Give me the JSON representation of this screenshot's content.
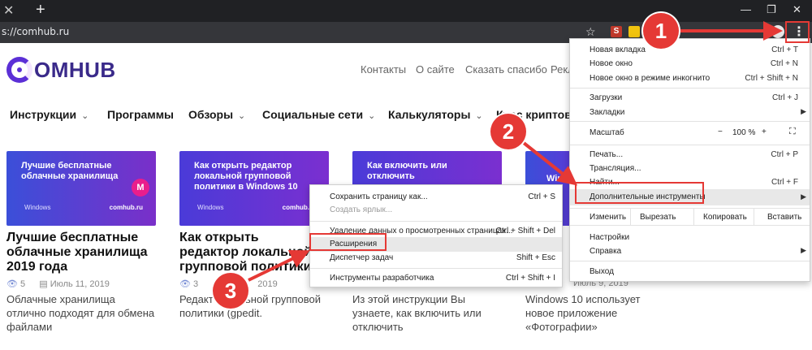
{
  "browser": {
    "url": "s://comhub.ru",
    "tab_close_glyph": "✕",
    "new_tab_glyph": "+",
    "window_controls": [
      "—",
      "❐",
      "✕"
    ],
    "ext_badge_letter": "S"
  },
  "site": {
    "logo_text": "OMHUB",
    "top_links": [
      "Контакты",
      "О сайте",
      "Сказать спасибо",
      "Рекл"
    ],
    "nav": [
      {
        "label": "Инструкции",
        "has_dropdown": true
      },
      {
        "label": "Программы",
        "has_dropdown": false
      },
      {
        "label": "Обзоры",
        "has_dropdown": true
      },
      {
        "label": "Социальные сети",
        "has_dropdown": true
      },
      {
        "label": "Калькуляторы",
        "has_dropdown": true
      },
      {
        "label": "Курс криптов",
        "has_dropdown": false
      }
    ],
    "articles": [
      {
        "thumb_text": "Лучшие бесплатные облачные хранилища",
        "thumb_footer_left": "Windows",
        "thumb_footer_right": "comhub.ru",
        "title": "Лучшие бесплатные облачные хранилища 2019 года",
        "views": "5",
        "date": "Июль 11, 2019",
        "excerpt": "Облачные хранилища отлично подходят для обмена файлами"
      },
      {
        "thumb_text": "Как открыть редактор локальной групповой политики в Windows 10",
        "thumb_footer_left": "Windows",
        "thumb_footer_right": "comhub.ru",
        "title": "Как открыть редактор локальной групповой политики в Windows 1",
        "views": "3",
        "date": "2019",
        "excerpt": "Редакт локальной групповой политики (gpedit."
      },
      {
        "thumb_text": "Как включить или отключить автоматическое обновление в Windows 10",
        "title": "",
        "excerpt": "Из этой инструкции Вы узнаете, как включить или отключить"
      },
      {
        "thumb_text": "Wind",
        "date": "Июль 9, 2019",
        "excerpt": "Windows 10 использует новое приложение «Фотографии»"
      }
    ]
  },
  "chrome_menu": {
    "items": [
      {
        "label": "Новая вкладка",
        "shortcut": "Ctrl + T"
      },
      {
        "label": "Новое окно",
        "shortcut": "Ctrl + N"
      },
      {
        "label": "Новое окно в режиме инкогнито",
        "shortcut": "Ctrl + Shift + N"
      },
      {
        "label": "Загрузки",
        "shortcut": "Ctrl + J"
      },
      {
        "label": "Закладки",
        "shortcut": ""
      },
      {
        "label": "Печать...",
        "shortcut": "Ctrl + P"
      },
      {
        "label": "Трансляция...",
        "shortcut": ""
      },
      {
        "label": "Найти...",
        "shortcut": "Ctrl + F"
      },
      {
        "label": "Дополнительные инструменты",
        "shortcut": ""
      },
      {
        "label": "Настройки",
        "shortcut": ""
      },
      {
        "label": "Справка",
        "shortcut": ""
      },
      {
        "label": "Выход",
        "shortcut": ""
      }
    ],
    "zoom": {
      "label": "Масштаб",
      "minus": "−",
      "value": "100 %",
      "plus": "+"
    },
    "edit": {
      "label": "Изменить",
      "cut": "Вырезать",
      "copy": "Копировать",
      "paste": "Вставить"
    }
  },
  "submenu": {
    "items": [
      {
        "label": "Сохранить страницу как...",
        "shortcut": "Ctrl + S"
      },
      {
        "label": "Создать ярлык...",
        "shortcut": ""
      },
      {
        "label": "Удаление данных о просмотренных страницах...",
        "shortcut": "Ctrl + Shift + Del"
      },
      {
        "label": "Расширения",
        "shortcut": ""
      },
      {
        "label": "Диспетчер задач",
        "shortcut": "Shift + Esc"
      },
      {
        "label": "Инструменты разработчика",
        "shortcut": "Ctrl + Shift + I"
      }
    ]
  },
  "annotations": {
    "step1": "1",
    "step2": "2",
    "step3": "3",
    "color": "#e53935"
  },
  "colors": {
    "brand": "#5b2fd6",
    "thumb_gradient_start": "#4a3bd8",
    "thumb_gradient_end": "#7b2fd0"
  }
}
